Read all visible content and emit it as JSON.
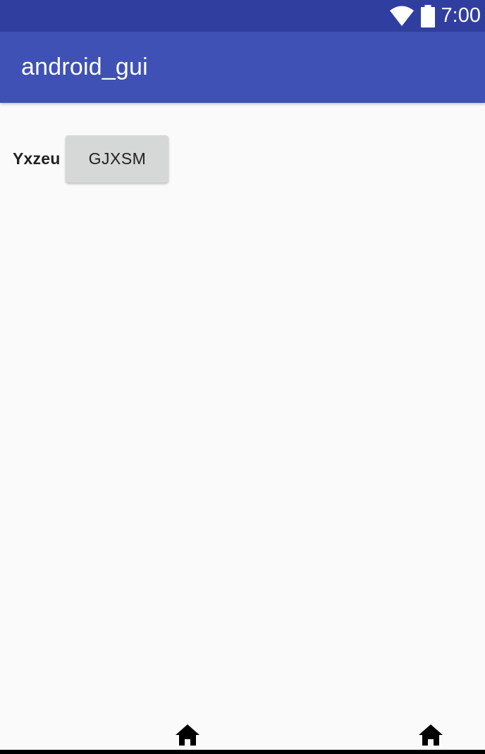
{
  "status_bar": {
    "time": "7:00",
    "icons": [
      "wifi-icon",
      "battery-icon"
    ],
    "background": "#303f9f"
  },
  "app_bar": {
    "title": "android_gui",
    "background": "#3f51b5"
  },
  "content": {
    "label": "Yxzeu",
    "button_label": "GJXSM"
  },
  "navigation": {
    "icons": [
      "home-icon",
      "home-icon"
    ]
  }
}
